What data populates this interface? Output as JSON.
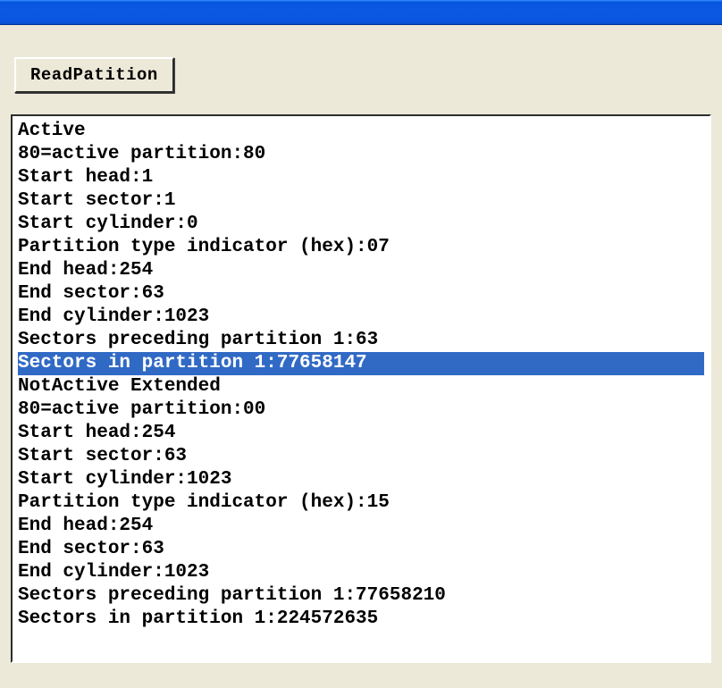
{
  "toolbar": {
    "read_button_label": "ReadPatition"
  },
  "output": {
    "lines": [
      {
        "text": "Active",
        "selected": false
      },
      {
        "text": "80=active partition:80",
        "selected": false
      },
      {
        "text": "Start head:1",
        "selected": false
      },
      {
        "text": "Start sector:1",
        "selected": false
      },
      {
        "text": "Start cylinder:0",
        "selected": false
      },
      {
        "text": "Partition type indicator (hex):07",
        "selected": false
      },
      {
        "text": "End head:254",
        "selected": false
      },
      {
        "text": "End sector:63",
        "selected": false
      },
      {
        "text": "End cylinder:1023",
        "selected": false
      },
      {
        "text": "Sectors preceding partition 1:63",
        "selected": false
      },
      {
        "text": "Sectors in partition 1:77658147",
        "selected": true
      },
      {
        "text": "NotActive Extended",
        "selected": false
      },
      {
        "text": "80=active partition:00",
        "selected": false
      },
      {
        "text": "Start head:254",
        "selected": false
      },
      {
        "text": "Start sector:63",
        "selected": false
      },
      {
        "text": "Start cylinder:1023",
        "selected": false
      },
      {
        "text": "Partition type indicator (hex):15",
        "selected": false
      },
      {
        "text": "End head:254",
        "selected": false
      },
      {
        "text": "End sector:63",
        "selected": false
      },
      {
        "text": "End cylinder:1023",
        "selected": false
      },
      {
        "text": "Sectors preceding partition 1:77658210",
        "selected": false
      },
      {
        "text": "Sectors in partition 1:224572635",
        "selected": false
      }
    ]
  }
}
